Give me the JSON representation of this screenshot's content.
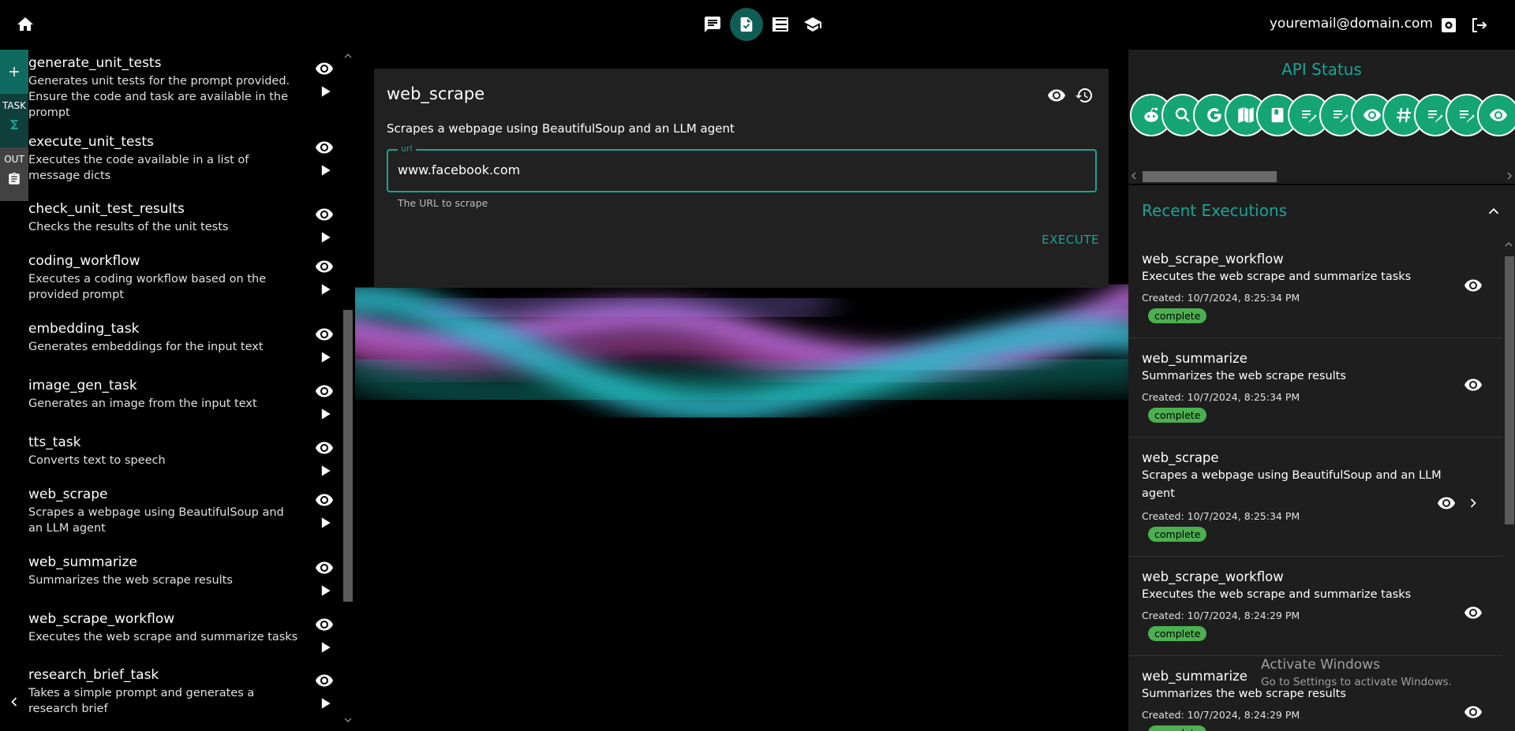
{
  "header": {
    "user_email": "youremail@domain.com",
    "nav": [
      "chat-icon",
      "tasks-icon",
      "list-icon",
      "school-icon"
    ]
  },
  "sidebar": {
    "tabs": {
      "add_icon": "plus-icon",
      "task_label": "TASK",
      "out_label": "OUT"
    },
    "tasks": [
      {
        "name": "generate_unit_tests",
        "desc": "Generates unit tests for the prompt provided. Ensure the code and task are available in the prompt"
      },
      {
        "name": "execute_unit_tests",
        "desc": "Executes the code available in a list of message dicts"
      },
      {
        "name": "check_unit_test_results",
        "desc": "Checks the results of the unit tests"
      },
      {
        "name": "coding_workflow",
        "desc": "Executes a coding workflow based on the provided prompt"
      },
      {
        "name": "embedding_task",
        "desc": "Generates embeddings for the input text"
      },
      {
        "name": "image_gen_task",
        "desc": "Generates an image from the input text"
      },
      {
        "name": "tts_task",
        "desc": "Converts text to speech"
      },
      {
        "name": "web_scrape",
        "desc": "Scrapes a webpage using BeautifulSoup and an LLM agent"
      },
      {
        "name": "web_summarize",
        "desc": "Summarizes the web scrape results"
      },
      {
        "name": "web_scrape_workflow",
        "desc": "Executes the web scrape and summarize tasks"
      },
      {
        "name": "research_brief_task",
        "desc": "Takes a simple prompt and generates a research brief"
      }
    ]
  },
  "task_card": {
    "title": "web_scrape",
    "description": "Scrapes a webpage using BeautifulSoup and an LLM agent",
    "field_label": "url",
    "field_value": "www.facebook.com",
    "field_helper": "The URL to scrape",
    "execute_label": "EXECUTE"
  },
  "api_status": {
    "title": "API Status",
    "icons": [
      "reddit-icon",
      "search-icon",
      "google-icon",
      "map-book-icon",
      "book-icon",
      "edit-note-icon",
      "edit-note-icon",
      "eye-icon",
      "hashtag-icon",
      "edit-note-icon",
      "edit-note-icon",
      "eye-icon"
    ],
    "status_color": "#15a574"
  },
  "recent": {
    "title": "Recent Executions",
    "items": [
      {
        "name": "web_scrape_workflow",
        "desc": "Executes the web scrape and summarize tasks",
        "created": "Created: 10/7/2024, 8:25:34 PM",
        "status": "complete"
      },
      {
        "name": "web_summarize",
        "desc": "Summarizes the web scrape results",
        "created": "Created: 10/7/2024, 8:25:34 PM",
        "status": "complete"
      },
      {
        "name": "web_scrape",
        "desc": "Scrapes a webpage using BeautifulSoup and an LLM agent",
        "created": "Created: 10/7/2024, 8:25:34 PM",
        "status": "complete"
      },
      {
        "name": "web_scrape_workflow",
        "desc": "Executes the web scrape and summarize tasks",
        "created": "Created: 10/7/2024, 8:24:29 PM",
        "status": "complete"
      },
      {
        "name": "web_summarize",
        "desc": "Summarizes the web scrape results",
        "created": "Created: 10/7/2024, 8:24:29 PM",
        "status": "complete"
      }
    ]
  },
  "watermark": {
    "title": "Activate Windows",
    "subtitle": "Go to Settings to activate Windows."
  },
  "colors": {
    "accent": "#1aa394",
    "badge": "#4caf50",
    "panel": "#212121"
  }
}
